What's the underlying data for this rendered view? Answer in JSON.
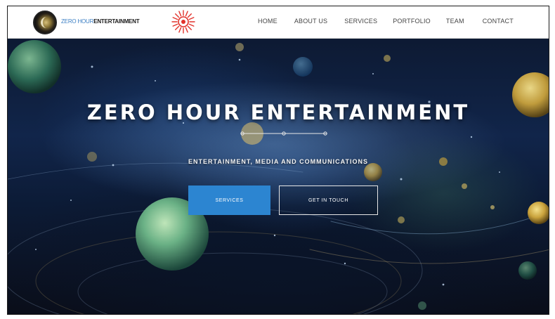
{
  "header": {
    "logo": {
      "text_primary": "ZERO HOUR",
      "text_secondary": "ENTERTAINMENT",
      "primary_color": "#3c7fc4",
      "emblem_icon": "zero-hour-emblem-icon",
      "badge_icon": "sunburst-icon",
      "badge_color": "#e2332c"
    },
    "nav": [
      {
        "label": "HOME"
      },
      {
        "label": "ABOUT US"
      },
      {
        "label": "SERVICES"
      },
      {
        "label": "PORTFOLIO"
      },
      {
        "label": "TEAM"
      },
      {
        "label": "CONTACT"
      }
    ]
  },
  "hero": {
    "title": "ZERO HOUR ENTERTAINMENT",
    "subtitle": "ENTERTAINMENT, MEDIA AND COMMUNICATIONS",
    "primary_button": "SERVICES",
    "secondary_button": "GET IN TOUCH",
    "accent_color": "#2c85d1"
  }
}
